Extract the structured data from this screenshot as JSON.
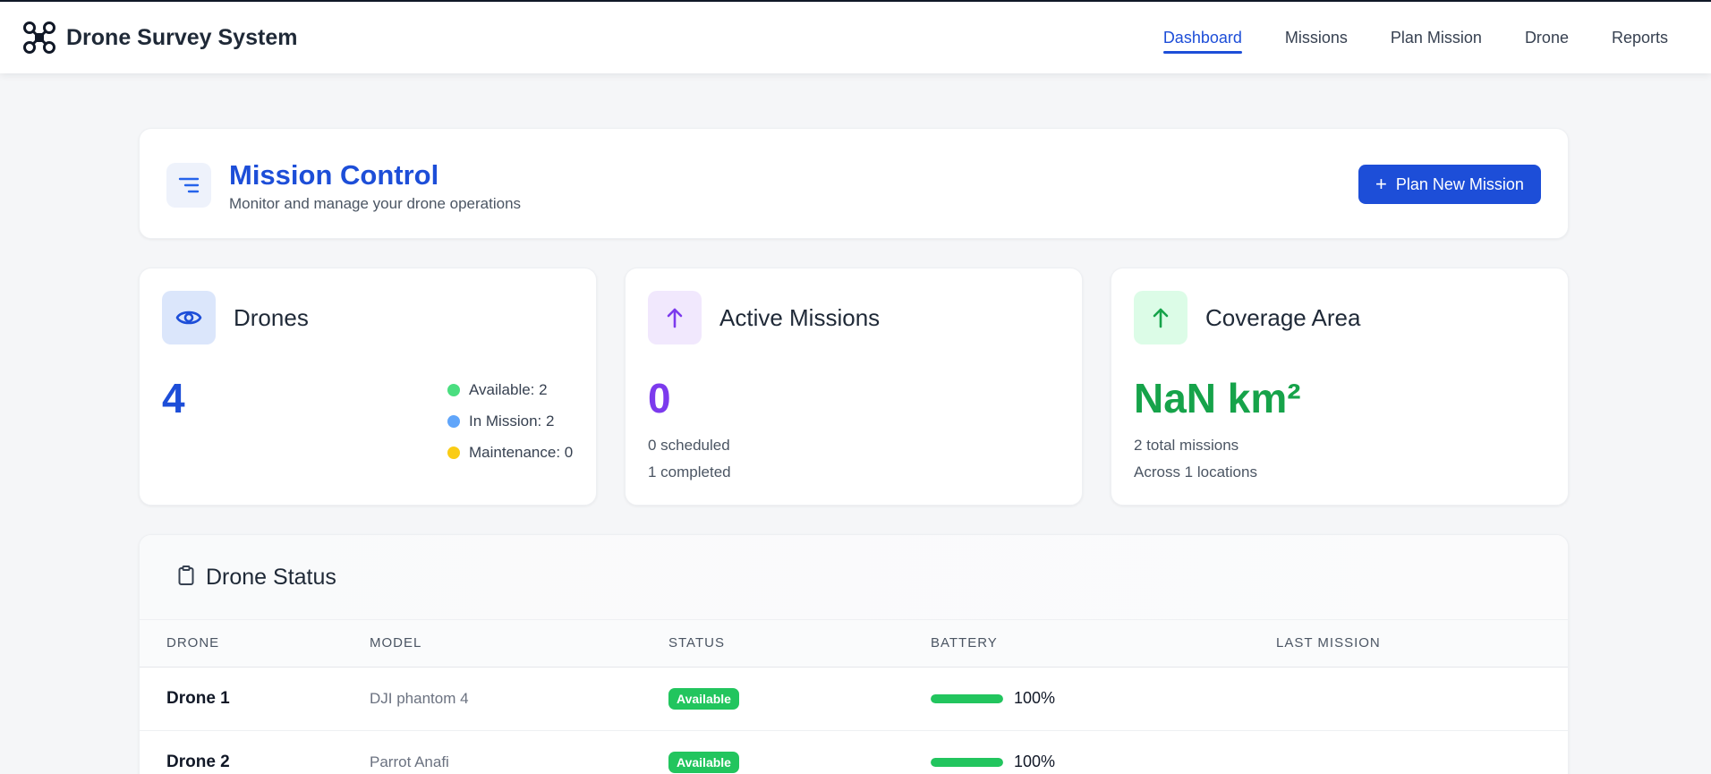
{
  "app": {
    "brand_title": "Drone Survey System",
    "brand_icon": "drone-icon"
  },
  "nav": {
    "items": [
      {
        "label": "Dashboard",
        "active": true
      },
      {
        "label": "Missions",
        "active": false
      },
      {
        "label": "Plan Mission",
        "active": false
      },
      {
        "label": "Drone",
        "active": false
      },
      {
        "label": "Reports",
        "active": false
      }
    ]
  },
  "header": {
    "icon": "menu-lines-icon",
    "title": "Mission Control",
    "subtitle": "Monitor and manage your drone operations",
    "plan_button_icon": "plus-icon",
    "plan_button_label": "Plan New Mission"
  },
  "stats": {
    "drones": {
      "icon": "eye-icon",
      "title": "Drones",
      "value": "4",
      "legend": [
        {
          "label": "Available: 2",
          "color": "#4ade80"
        },
        {
          "label": "In Mission: 2",
          "color": "#60a5fa"
        },
        {
          "label": "Maintenance: 0",
          "color": "#facc15"
        }
      ]
    },
    "active_missions": {
      "icon": "arrow-up-icon",
      "title": "Active Missions",
      "value": "0",
      "line1": "0 scheduled",
      "line2": "1 completed"
    },
    "coverage": {
      "icon": "arrow-up-icon",
      "title": "Coverage Area",
      "value": "NaN km²",
      "line1": "2 total missions",
      "line2": "Across 1 locations"
    }
  },
  "drone_status": {
    "icon": "clipboard-icon",
    "title": "Drone Status",
    "columns": [
      "DRONE",
      "MODEL",
      "STATUS",
      "BATTERY",
      "LAST MISSION"
    ],
    "rows": [
      {
        "drone": "Drone 1",
        "model": "DJI phantom 4",
        "status": "Available",
        "battery_pct": 100,
        "battery_label": "100%",
        "last_mission": ""
      },
      {
        "drone": "Drone 2",
        "model": "Parrot Anafi",
        "status": "Available",
        "battery_pct": 100,
        "battery_label": "100%",
        "last_mission": ""
      }
    ]
  },
  "colors": {
    "primary": "#1d4ed8",
    "purple": "#7c3aed",
    "green": "#16a34a",
    "status_available": "#22c55e",
    "battery_fill": "#22c55e"
  }
}
